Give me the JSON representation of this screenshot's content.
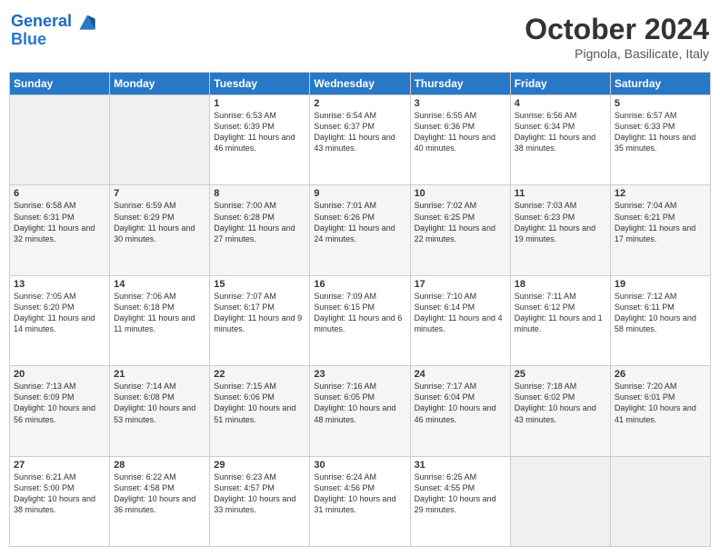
{
  "header": {
    "logo_line1": "General",
    "logo_line2": "Blue",
    "month": "October 2024",
    "location": "Pignola, Basilicate, Italy"
  },
  "days_of_week": [
    "Sunday",
    "Monday",
    "Tuesday",
    "Wednesday",
    "Thursday",
    "Friday",
    "Saturday"
  ],
  "weeks": [
    [
      {
        "day": "",
        "sunrise": "",
        "sunset": "",
        "daylight": ""
      },
      {
        "day": "",
        "sunrise": "",
        "sunset": "",
        "daylight": ""
      },
      {
        "day": "1",
        "sunrise": "Sunrise: 6:53 AM",
        "sunset": "Sunset: 6:39 PM",
        "daylight": "Daylight: 11 hours and 46 minutes."
      },
      {
        "day": "2",
        "sunrise": "Sunrise: 6:54 AM",
        "sunset": "Sunset: 6:37 PM",
        "daylight": "Daylight: 11 hours and 43 minutes."
      },
      {
        "day": "3",
        "sunrise": "Sunrise: 6:55 AM",
        "sunset": "Sunset: 6:36 PM",
        "daylight": "Daylight: 11 hours and 40 minutes."
      },
      {
        "day": "4",
        "sunrise": "Sunrise: 6:56 AM",
        "sunset": "Sunset: 6:34 PM",
        "daylight": "Daylight: 11 hours and 38 minutes."
      },
      {
        "day": "5",
        "sunrise": "Sunrise: 6:57 AM",
        "sunset": "Sunset: 6:33 PM",
        "daylight": "Daylight: 11 hours and 35 minutes."
      }
    ],
    [
      {
        "day": "6",
        "sunrise": "Sunrise: 6:58 AM",
        "sunset": "Sunset: 6:31 PM",
        "daylight": "Daylight: 11 hours and 32 minutes."
      },
      {
        "day": "7",
        "sunrise": "Sunrise: 6:59 AM",
        "sunset": "Sunset: 6:29 PM",
        "daylight": "Daylight: 11 hours and 30 minutes."
      },
      {
        "day": "8",
        "sunrise": "Sunrise: 7:00 AM",
        "sunset": "Sunset: 6:28 PM",
        "daylight": "Daylight: 11 hours and 27 minutes."
      },
      {
        "day": "9",
        "sunrise": "Sunrise: 7:01 AM",
        "sunset": "Sunset: 6:26 PM",
        "daylight": "Daylight: 11 hours and 24 minutes."
      },
      {
        "day": "10",
        "sunrise": "Sunrise: 7:02 AM",
        "sunset": "Sunset: 6:25 PM",
        "daylight": "Daylight: 11 hours and 22 minutes."
      },
      {
        "day": "11",
        "sunrise": "Sunrise: 7:03 AM",
        "sunset": "Sunset: 6:23 PM",
        "daylight": "Daylight: 11 hours and 19 minutes."
      },
      {
        "day": "12",
        "sunrise": "Sunrise: 7:04 AM",
        "sunset": "Sunset: 6:21 PM",
        "daylight": "Daylight: 11 hours and 17 minutes."
      }
    ],
    [
      {
        "day": "13",
        "sunrise": "Sunrise: 7:05 AM",
        "sunset": "Sunset: 6:20 PM",
        "daylight": "Daylight: 11 hours and 14 minutes."
      },
      {
        "day": "14",
        "sunrise": "Sunrise: 7:06 AM",
        "sunset": "Sunset: 6:18 PM",
        "daylight": "Daylight: 11 hours and 11 minutes."
      },
      {
        "day": "15",
        "sunrise": "Sunrise: 7:07 AM",
        "sunset": "Sunset: 6:17 PM",
        "daylight": "Daylight: 11 hours and 9 minutes."
      },
      {
        "day": "16",
        "sunrise": "Sunrise: 7:09 AM",
        "sunset": "Sunset: 6:15 PM",
        "daylight": "Daylight: 11 hours and 6 minutes."
      },
      {
        "day": "17",
        "sunrise": "Sunrise: 7:10 AM",
        "sunset": "Sunset: 6:14 PM",
        "daylight": "Daylight: 11 hours and 4 minutes."
      },
      {
        "day": "18",
        "sunrise": "Sunrise: 7:11 AM",
        "sunset": "Sunset: 6:12 PM",
        "daylight": "Daylight: 11 hours and 1 minute."
      },
      {
        "day": "19",
        "sunrise": "Sunrise: 7:12 AM",
        "sunset": "Sunset: 6:11 PM",
        "daylight": "Daylight: 10 hours and 58 minutes."
      }
    ],
    [
      {
        "day": "20",
        "sunrise": "Sunrise: 7:13 AM",
        "sunset": "Sunset: 6:09 PM",
        "daylight": "Daylight: 10 hours and 56 minutes."
      },
      {
        "day": "21",
        "sunrise": "Sunrise: 7:14 AM",
        "sunset": "Sunset: 6:08 PM",
        "daylight": "Daylight: 10 hours and 53 minutes."
      },
      {
        "day": "22",
        "sunrise": "Sunrise: 7:15 AM",
        "sunset": "Sunset: 6:06 PM",
        "daylight": "Daylight: 10 hours and 51 minutes."
      },
      {
        "day": "23",
        "sunrise": "Sunrise: 7:16 AM",
        "sunset": "Sunset: 6:05 PM",
        "daylight": "Daylight: 10 hours and 48 minutes."
      },
      {
        "day": "24",
        "sunrise": "Sunrise: 7:17 AM",
        "sunset": "Sunset: 6:04 PM",
        "daylight": "Daylight: 10 hours and 46 minutes."
      },
      {
        "day": "25",
        "sunrise": "Sunrise: 7:18 AM",
        "sunset": "Sunset: 6:02 PM",
        "daylight": "Daylight: 10 hours and 43 minutes."
      },
      {
        "day": "26",
        "sunrise": "Sunrise: 7:20 AM",
        "sunset": "Sunset: 6:01 PM",
        "daylight": "Daylight: 10 hours and 41 minutes."
      }
    ],
    [
      {
        "day": "27",
        "sunrise": "Sunrise: 6:21 AM",
        "sunset": "Sunset: 5:00 PM",
        "daylight": "Daylight: 10 hours and 38 minutes."
      },
      {
        "day": "28",
        "sunrise": "Sunrise: 6:22 AM",
        "sunset": "Sunset: 4:58 PM",
        "daylight": "Daylight: 10 hours and 36 minutes."
      },
      {
        "day": "29",
        "sunrise": "Sunrise: 6:23 AM",
        "sunset": "Sunset: 4:57 PM",
        "daylight": "Daylight: 10 hours and 33 minutes."
      },
      {
        "day": "30",
        "sunrise": "Sunrise: 6:24 AM",
        "sunset": "Sunset: 4:56 PM",
        "daylight": "Daylight: 10 hours and 31 minutes."
      },
      {
        "day": "31",
        "sunrise": "Sunrise: 6:25 AM",
        "sunset": "Sunset: 4:55 PM",
        "daylight": "Daylight: 10 hours and 29 minutes."
      },
      {
        "day": "",
        "sunrise": "",
        "sunset": "",
        "daylight": ""
      },
      {
        "day": "",
        "sunrise": "",
        "sunset": "",
        "daylight": ""
      }
    ]
  ]
}
